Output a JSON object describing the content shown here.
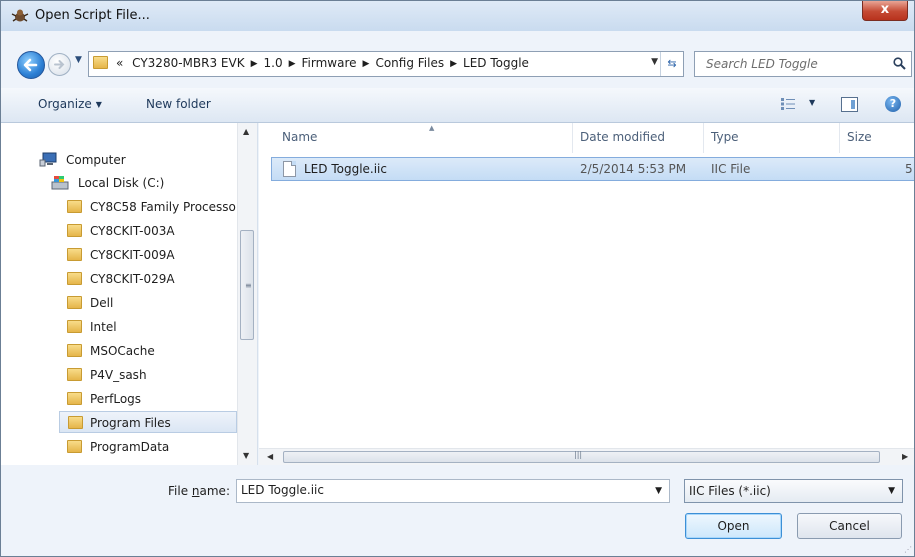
{
  "window": {
    "title": "Open Script File...",
    "close_label": "x"
  },
  "address": {
    "prefix": "«",
    "crumbs": [
      "CY3280-MBR3 EVK",
      "1.0",
      "Firmware",
      "Config Files",
      "LED Toggle"
    ]
  },
  "search": {
    "placeholder": "Search LED Toggle"
  },
  "toolbar": {
    "organize_label": "Organize",
    "new_folder_label": "New folder"
  },
  "nav": {
    "computer": "Computer",
    "local_disk": "Local Disk (C:)",
    "folders": [
      "CY8C58 Family Processo",
      "CY8CKIT-003A",
      "CY8CKIT-009A",
      "CY8CKIT-029A",
      "Dell",
      "Intel",
      "MSOCache",
      "P4V_sash",
      "PerfLogs",
      "Program Files",
      "ProgramData"
    ],
    "selected": "Program Files"
  },
  "file_list": {
    "columns": {
      "name": "Name",
      "date": "Date modified",
      "type": "Type",
      "size": "Size"
    },
    "rows": [
      {
        "name": "LED Toggle.iic",
        "date": "2/5/2014 5:53 PM",
        "type": "IIC File",
        "size": "5"
      }
    ]
  },
  "footer": {
    "file_name_label": "File name:",
    "file_name_underline_char": "n",
    "file_name_value": "LED Toggle.iic",
    "file_type_value": "IIC Files (*.iic)",
    "open_label": "Open",
    "cancel_label": "Cancel"
  },
  "colors": {
    "accent": "#3c8fd6",
    "close": "#c54a34",
    "selection": "#c4dcf5"
  }
}
